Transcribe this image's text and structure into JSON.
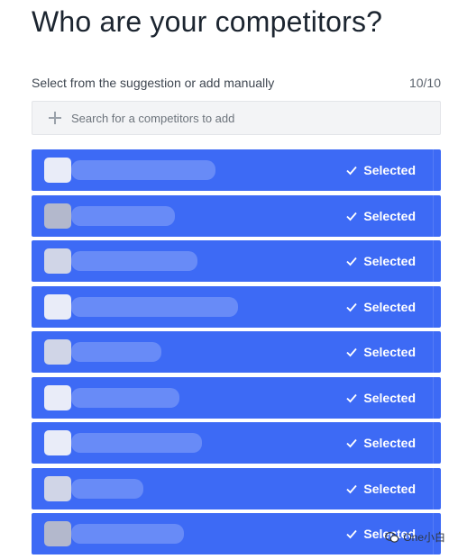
{
  "header": {
    "title": "Who are your competitors?",
    "subtitle": "Select from the suggestion or add manually",
    "counter": "10/10"
  },
  "search": {
    "placeholder": "Search for a competitors to add",
    "icon": "plus-icon"
  },
  "competitors": [
    {
      "status": "Selected"
    },
    {
      "status": "Selected"
    },
    {
      "status": "Selected"
    },
    {
      "status": "Selected"
    },
    {
      "status": "Selected"
    },
    {
      "status": "Selected"
    },
    {
      "status": "Selected"
    },
    {
      "status": "Selected"
    },
    {
      "status": "Selected"
    }
  ],
  "watermark": {
    "text": "One小白"
  },
  "colors": {
    "accent": "#3d6af5",
    "title": "#1c2530",
    "search_bg": "#f3f4f6"
  }
}
